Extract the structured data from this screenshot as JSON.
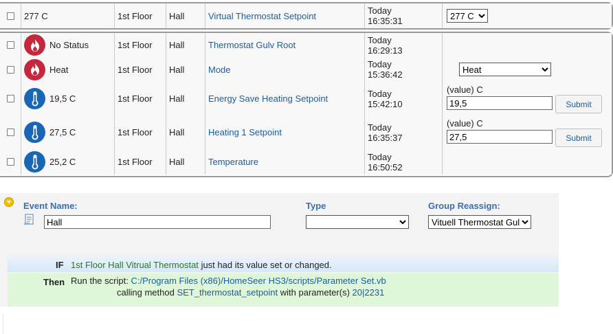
{
  "top_row": {
    "status": "277 C",
    "floor": "1st Floor",
    "room": "Hall",
    "name": "Virtual Thermostat Setpoint",
    "time_day": "Today",
    "time_clock": "16:35:31",
    "select_value": "277 C"
  },
  "rows": [
    {
      "icon": "flame-icon",
      "status": "No Status",
      "floor": "1st Floor",
      "room": "Hall",
      "name": "Thermostat Gulv Root",
      "time_day": "Today",
      "time_clock": "16:29:13"
    },
    {
      "icon": "flame-icon",
      "status": "Heat",
      "floor": "1st Floor",
      "room": "Hall",
      "name": "Mode",
      "time_day": "Today",
      "time_clock": "15:36:42",
      "select_value": "Heat"
    },
    {
      "icon": "thermometer-icon",
      "status": "19,5 C",
      "floor": "1st Floor",
      "room": "Hall",
      "name": "Energy Save Heating Setpoint",
      "time_day": "Today",
      "time_clock": "15:42:10",
      "input_label": "(value) C",
      "input_value": "19,5",
      "button": "Submit"
    },
    {
      "icon": "thermometer-icon",
      "status": "27,5 C",
      "floor": "1st Floor",
      "room": "Hall",
      "name": "Heating 1 Setpoint",
      "time_day": "Today",
      "time_clock": "16:35:37",
      "input_label": "(value) C",
      "input_value": "27,5",
      "button": "Submit"
    },
    {
      "icon": "thermometer-icon",
      "status": "25,2 C",
      "floor": "1st Floor",
      "room": "Hall",
      "name": "Temperature",
      "time_day": "Today",
      "time_clock": "16:50:52"
    }
  ],
  "event": {
    "name_label": "Event Name:",
    "name_value": "Hall",
    "type_label": "Type",
    "type_value": "",
    "group_label": "Group Reassign:",
    "group_value": "Vituell Thermostat Gulv",
    "if_keyword": "IF",
    "if_device": "1st Floor Hall Vitrual Thermostat",
    "if_text": "just had its value set or changed.",
    "then_keyword": "Then",
    "then_prefix": "Run the script:",
    "then_script": "C:/Program Files (x86)/HomeSeer HS3/scripts/Parameter Set.vb",
    "then_calling": "calling method",
    "then_method": "SET_thermostat_setpoint",
    "then_with": "with parameter(s)",
    "then_params": "20|2231"
  },
  "colors": {
    "link": "#1a5e9a",
    "flame_icon_bg": "#c3283c",
    "thermometer_icon_bg": "#1866b4",
    "event_label": "#3a6fb0",
    "if_device": "#2a7a1e",
    "then_bg": "#dff6d8"
  }
}
